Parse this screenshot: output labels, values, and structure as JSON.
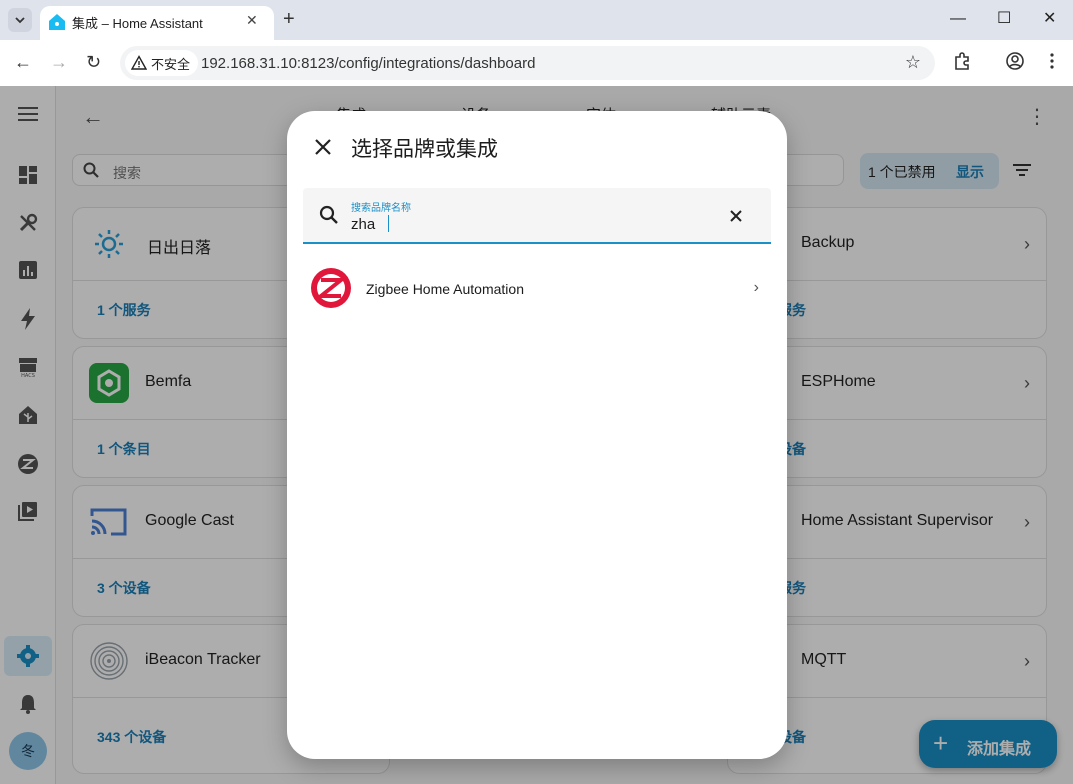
{
  "browser": {
    "tab_title": "集成 – Home Assistant",
    "security_label": "不安全",
    "url": "192.168.31.10:8123/config/integrations/dashboard"
  },
  "app": {
    "nav_tabs": [
      "集成",
      "设备",
      "实体",
      "辅助元素"
    ],
    "search_placeholder": "搜索",
    "disabled_label": "1 个已禁用",
    "show_label": "显示",
    "avatar_initial": "冬",
    "fab_label": "添加集成",
    "accent_color": "#1a8fc8"
  },
  "cards": [
    {
      "name": "日出日落",
      "link": "1 个服务"
    },
    {
      "name": "Backup",
      "link": "服务"
    },
    {
      "name": "Bemfa",
      "link": "1 个条目"
    },
    {
      "name": "ESPHome",
      "link": "设备"
    },
    {
      "name": "Google Cast",
      "link": "3 个设备"
    },
    {
      "name": "Home Assistant Supervisor",
      "link": "服务"
    },
    {
      "name": "iBeacon Tracker",
      "link": "343 个设备"
    },
    {
      "name": "MQTT",
      "link": "设备"
    }
  ],
  "dialog": {
    "title": "选择品牌或集成",
    "search_label": "搜索品牌名称",
    "search_value": "zha",
    "results": [
      {
        "name": "Zigbee Home Automation"
      }
    ]
  }
}
